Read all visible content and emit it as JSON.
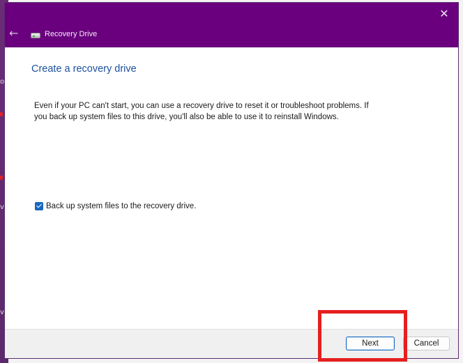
{
  "window": {
    "title": "Recovery Drive",
    "close_glyph": "✕",
    "back_glyph": "←"
  },
  "background": {
    "glyphs": [
      "o",
      "v",
      "v"
    ]
  },
  "content": {
    "heading": "Create a recovery drive",
    "description_line1": "Even if your PC can't start, you can use a recovery drive to reset it or troubleshoot problems. If",
    "description_line2": "you back up system files to this drive, you'll also be able to use it to reinstall Windows.",
    "backup_checkbox": {
      "label": "Back up system files to the recovery drive.",
      "checked": true
    }
  },
  "footer": {
    "next_label": "Next",
    "cancel_label": "Cancel"
  },
  "colors": {
    "titlebar": "#6a007e",
    "heading": "#1a4f9c",
    "accent": "#1867c0",
    "highlight": "#e51f1f"
  },
  "icons": {
    "close": "close-icon",
    "back": "back-arrow-icon",
    "app": "drive-icon",
    "check": "checkmark-icon"
  }
}
